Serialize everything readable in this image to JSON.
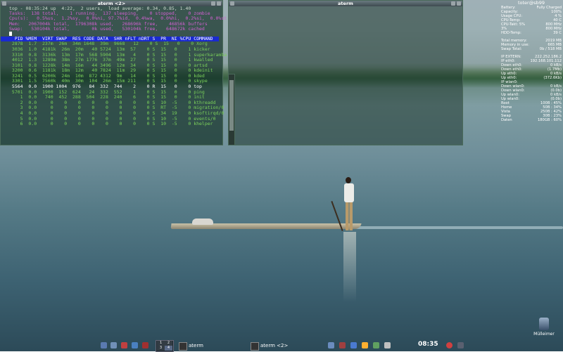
{
  "term1": {
    "title": "aterm <2>",
    "summary": [
      "top - 08:35:24 up  4:22,  2 users,  load average: 0.34, 0.85, 1.40",
      "Tasks:  138 total,    1 running,  137 sleeping,    0 stopped,    0 zombie",
      "Cpu(s):   0.5%us,  1.2%sy,  0.0%ni, 97.7%id,  0.4%wa,  0.0%hi,  0.2%si,  0.0%st",
      "Mem:   2067004k total,  1796308k used,   268696k free,    46856k buffers",
      "Swap:   530104k total,        0k used,   530104k free,   648672k cached"
    ],
    "header": "  PID %MEM  VIRT SWAP  RES CODE DATA  SHR nFLT nDRT S  PR  NI %CPU COMMAND",
    "processes": [
      " 2878  1.7  237m  26m  34m 1648  39m  9668   12    0 S  15   0    0 Xorg",
      " 3036  1.0  4181k  26m  20m   40 5724  13m  57    0 S  15   0    1 kicker",
      " 3310  0.8  3136k  13m  17m  568 5904  13m   4    0 S  15   0    1 superkaramba",
      " 4012  1.3  1289m  38m  27m 1776  37m  49m  27    0 S  15   0    1 kwalled",
      " 3101  0.8  1228k  14m  16m   44 3496  12m  34    0 S  15   0    0 artsd",
      " 3200  0.6  1181k  18m  12m   40 7824  11m  29    0 S  15   0    0 kdeinit",
      " 3241  0.5  6200k  24m  10m  872 4312  9m   14    0 S  15   0    0 kded",
      " 3301  1.5  7560k  40m  30m  104  26m  15m 211    0 S  15   0    0 skype",
      " 5564  0.0  1900 1004  976   84  332  744    2    0 R  15   0    0 top",
      " 5701  0.0  1900  152  624   24  332  552    1    0 S  15   0    0 ping",
      "    1  0.0   740  452  288  504  228  240    6    0 S  15   0    0 init",
      "    2  0.0     0    0    0    0    0    0    0    0 S  10  -5    0 kthreadd",
      "    3  0.0     0    0    0    0    0    0    0    0 S  RT  -5    0 migration/0",
      "    4  0.0     0    0    0    0    0    0    0    0 S  34  19    0 ksoftirqd/0",
      "    5  0.0     0    0    0    0    0    0    0    0 S  10  -5    0 events/0",
      "    6  0.0     0    0    0    0    0    0    0    0 S  10  -5    0 khelper"
    ]
  },
  "term2": {
    "title": "aterm"
  },
  "conky": {
    "hostname": "toter@sb99",
    "rows": [
      [
        "Battery:",
        "Fully Charged"
      ],
      [
        "Capacity:",
        "100%"
      ],
      [
        "Usage CPU:",
        "4 %"
      ],
      [
        "CPU-Temp:",
        "40 C"
      ],
      [
        "CPU-Takt:  5%",
        "800 MHz"
      ],
      [
        "3%",
        "800 MHz"
      ],
      [
        "HDD-Temp:",
        "39 C"
      ],
      [
        "",
        ""
      ],
      [
        "Total memory:",
        "2019 MB"
      ],
      [
        "Memory in use:",
        "665 MB"
      ],
      [
        "Swap Total:",
        "0b / 518 MB"
      ],
      [
        "",
        ""
      ],
      [
        "IP EXTERN:",
        "222.252.186.2"
      ],
      [
        "IP eth0:",
        "192.168.101.112"
      ],
      [
        "Down eth0:",
        "0 kB/s"
      ],
      [
        "Down eth0:",
        "(1.7Mb)"
      ],
      [
        "Up eth0:",
        "0 kB/s"
      ],
      [
        "Up eth0:",
        "(372.6Kb)"
      ],
      [
        "IP wlan0:",
        ""
      ],
      [
        "Down wlan0:",
        "0 kB/s"
      ],
      [
        "Down wlan0:",
        "(0.0b)"
      ],
      [
        "Up wlan0:",
        "0 kB/s"
      ],
      [
        "Up wlan0:",
        "(0.0b)"
      ],
      [
        "Root",
        "100B : 45%"
      ],
      [
        "Home",
        "50B : 34%"
      ],
      [
        "Vista",
        "250B : 42%"
      ],
      [
        "Swap",
        "30B : 23%"
      ],
      [
        "Daten",
        "180GB : 60%"
      ]
    ]
  },
  "taskbar": {
    "pager": [
      "1",
      "2",
      "3",
      "4"
    ],
    "task_term": "aterm",
    "task_term2": "aterm <2>",
    "clock": "08:35",
    "icon_colors": [
      "#6a8cbf",
      "#a04040",
      "#4a7ad0",
      "#ffb030",
      "#60a060",
      "#c0c0c0"
    ]
  },
  "desktop": {
    "trash_label": "Mülleimer"
  }
}
